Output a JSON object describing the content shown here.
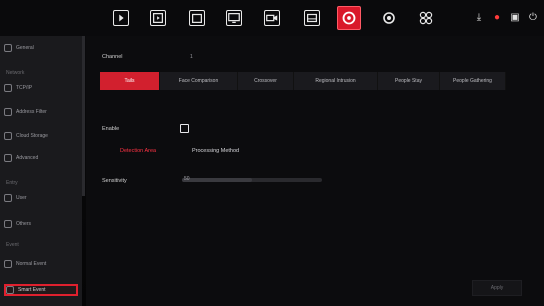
{
  "topbar": {
    "icons": [
      "play-icon",
      "film-icon",
      "files-icon",
      "monitor-icon",
      "camera-icon",
      "hdd-icon",
      "smart-event-icon",
      "settings-icon",
      "apps-icon"
    ],
    "active_icon": "smart-event-icon",
    "right_icons": [
      "download-icon",
      "alarm-icon",
      "lock-icon",
      "power-icon"
    ]
  },
  "sidebar": {
    "items": [
      {
        "label": "General",
        "icon": "gear-icon"
      },
      {
        "label": "Network",
        "icon": "none"
      },
      {
        "label": "TCP/IP",
        "icon": "network-icon"
      },
      {
        "label": "Address Filter",
        "icon": "filter-icon"
      },
      {
        "label": "Cloud Storage",
        "icon": "cloud-icon"
      },
      {
        "label": "Advanced",
        "icon": "advanced-icon"
      },
      {
        "label": "Entry",
        "icon": "none"
      },
      {
        "label": "User",
        "icon": "user-icon"
      },
      {
        "label": "Others",
        "icon": "others-icon"
      },
      {
        "label": "Event",
        "icon": "none"
      },
      {
        "label": "Normal Event",
        "icon": "bell-icon"
      },
      {
        "label": "Smart Event",
        "icon": "smart-icon"
      }
    ],
    "active_label": "Smart Event"
  },
  "content": {
    "channel_label": "Channel",
    "channel_value": "1",
    "tabs": [
      "Tails",
      "Face Comparison",
      "Crossover",
      "Regional Intrusion",
      "People Stay",
      "People Gathering"
    ],
    "active_tab": "Tails",
    "enable_label": "Enable",
    "subtabs": [
      "Detection Area",
      "Processing Method"
    ],
    "active_subtab": "Detection Area",
    "sensitivity_label": "Sensitivity",
    "sensitivity_value": "50",
    "bottom_button": "Apply"
  }
}
